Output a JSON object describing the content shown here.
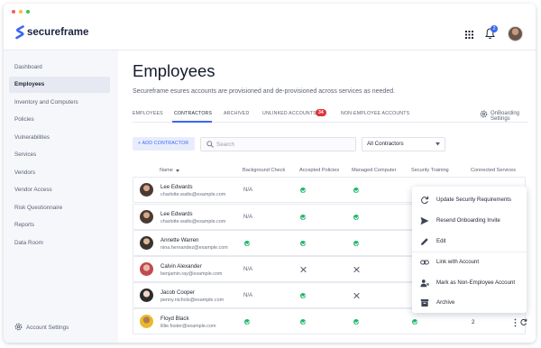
{
  "app": {
    "brand": "secureframe",
    "notification_count": "2"
  },
  "sidebar": {
    "items": [
      {
        "label": "Dashboard",
        "active": false
      },
      {
        "label": "Employees",
        "active": true
      },
      {
        "label": "Inventory and Computers",
        "active": false
      },
      {
        "label": "Policies",
        "active": false
      },
      {
        "label": "Vulnerabilities",
        "active": false
      },
      {
        "label": "Services",
        "active": false
      },
      {
        "label": "Vendors",
        "active": false
      },
      {
        "label": "Vendor Access",
        "active": false
      },
      {
        "label": "Risk Questionnaire",
        "active": false
      },
      {
        "label": "Reports",
        "active": false
      },
      {
        "label": "Data Room",
        "active": false
      }
    ],
    "account_settings": "Account Settings"
  },
  "page": {
    "title": "Employees",
    "subtitle": "Secureframe esures accounts are provisioned and de-provisioned across services as needed."
  },
  "tabs": [
    {
      "label": "EMPLOYEES"
    },
    {
      "label": "CONTRACTORS",
      "active": true
    },
    {
      "label": "ARCHIVED"
    },
    {
      "label": "UNLINKED ACCOUNTS",
      "badge": "34"
    },
    {
      "label": "NON-EMPLOYEE ACCOUNTS"
    }
  ],
  "onboarding_settings": "OnBoarding Settings",
  "toolbar": {
    "add_label": "+ ADD CONTRACTOR",
    "search_placeholder": "Search",
    "filter_value": "All Contractors"
  },
  "table": {
    "columns": [
      "Name",
      "Background Check",
      "Accepted Policies",
      "Managed Computer",
      "Security Training",
      "Connected Services"
    ],
    "rows": [
      {
        "name": "Lee Edwards",
        "email": "charlotte.watts@example.com",
        "background": "N/A",
        "policies": "ok",
        "computer": "ok",
        "training": "ok"
      },
      {
        "name": "Lee Edwards",
        "email": "charlotte.watts@example.com",
        "background": "N/A",
        "policies": "ok",
        "computer": "ok",
        "training": "ok"
      },
      {
        "name": "Annette Warren",
        "email": "nina.hernandez@example.com",
        "background": "ok",
        "policies": "ok",
        "computer": "ok",
        "training": "ok"
      },
      {
        "name": "Calvin Alexander",
        "email": "benjamin.ray@example.com",
        "background": "N/A",
        "policies": "no",
        "computer": "no",
        "training": "no"
      },
      {
        "name": "Jacob Cooper",
        "email": "penny.nichols@example.com",
        "background": "N/A",
        "policies": "ok",
        "computer": "no",
        "training": "no"
      },
      {
        "name": "Floyd Black",
        "email": "lillie.foster@example.com",
        "background": "ok",
        "policies": "ok",
        "computer": "ok",
        "training": "ok",
        "connected": "2"
      }
    ]
  },
  "row_menu": {
    "items": [
      {
        "label": "Update Security Requirements",
        "icon": "refresh-icon"
      },
      {
        "label": "Resend Onboarding Invite",
        "icon": "send-icon"
      },
      {
        "label": "Edit",
        "icon": "pencil-icon"
      },
      {
        "label": "Link with Account",
        "icon": "link-icon"
      },
      {
        "label": "Mark as Non-Employee Account",
        "icon": "user-remove-icon"
      },
      {
        "label": "Archive",
        "icon": "archive-icon"
      }
    ]
  },
  "colors": {
    "accent": "#3b67f5",
    "success": "#1eb56b",
    "danger": "#e2313b"
  }
}
